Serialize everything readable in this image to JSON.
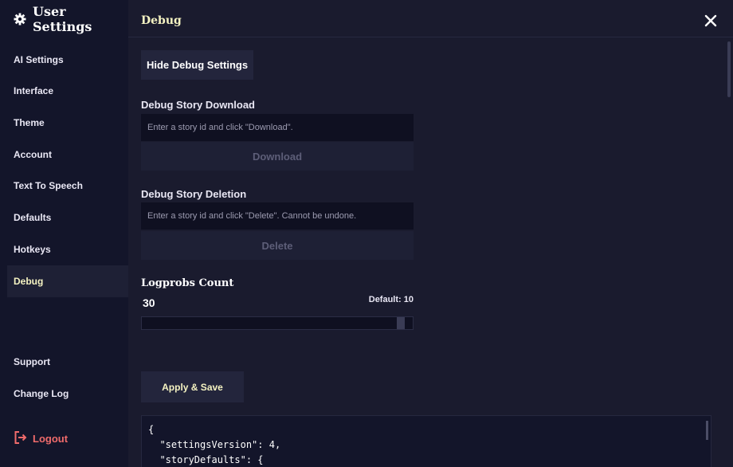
{
  "sidebar": {
    "title": "User Settings",
    "items": [
      {
        "label": "AI Settings"
      },
      {
        "label": "Interface"
      },
      {
        "label": "Theme"
      },
      {
        "label": "Account"
      },
      {
        "label": "Text To Speech"
      },
      {
        "label": "Defaults"
      },
      {
        "label": "Hotkeys"
      },
      {
        "label": "Debug",
        "active": true
      }
    ],
    "support_label": "Support",
    "changelog_label": "Change Log",
    "logout_label": "Logout"
  },
  "header": {
    "title": "Debug"
  },
  "debug": {
    "hide_button_label": "Hide Debug Settings",
    "download": {
      "label": "Debug Story Download",
      "placeholder": "Enter a story id and click \"Download\".",
      "value": "",
      "button_label": "Download"
    },
    "deletion": {
      "label": "Debug Story Deletion",
      "placeholder": "Enter a story id and click \"Delete\". Cannot be undone.",
      "value": "",
      "button_label": "Delete"
    },
    "logprobs": {
      "label": "Logprobs Count",
      "value": "30",
      "default_text": "Default: 10",
      "slider_fraction": 0.97
    },
    "apply_label": "Apply & Save",
    "json_lines": [
      "{",
      "  \"settingsVersion\": 4,",
      "  \"storyDefaults\": {"
    ]
  },
  "colors": {
    "accent": "#f5f3c2",
    "danger": "#f06b6b",
    "background": "#1a1b2e",
    "sidebar": "#13152a"
  }
}
